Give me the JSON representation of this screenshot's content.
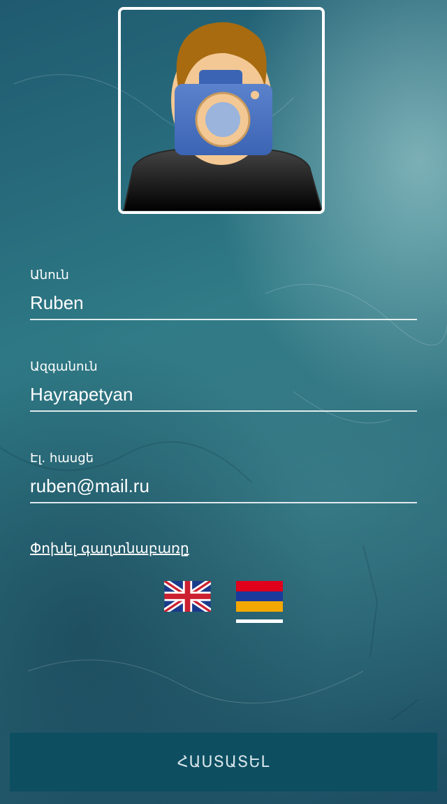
{
  "profile": {
    "avatar_icon": "camera-person-icon"
  },
  "form": {
    "first_name": {
      "label": "Անուն",
      "value": "Ruben"
    },
    "last_name": {
      "label": "Ազգանուն",
      "value": "Hayrapetyan"
    },
    "email": {
      "label": "Էլ. հասցե",
      "value": "ruben@mail.ru"
    },
    "change_password_link": "Փոխել գաղտնաբառը"
  },
  "languages": {
    "items": [
      {
        "name": "uk-flag-icon",
        "selected": false
      },
      {
        "name": "armenia-flag-icon",
        "selected": true
      }
    ]
  },
  "confirm_button": {
    "label": "ՀԱՍՏԱՏԵԼ"
  },
  "colors": {
    "button_bg": "#0d4e61",
    "text": "#ffffff"
  }
}
